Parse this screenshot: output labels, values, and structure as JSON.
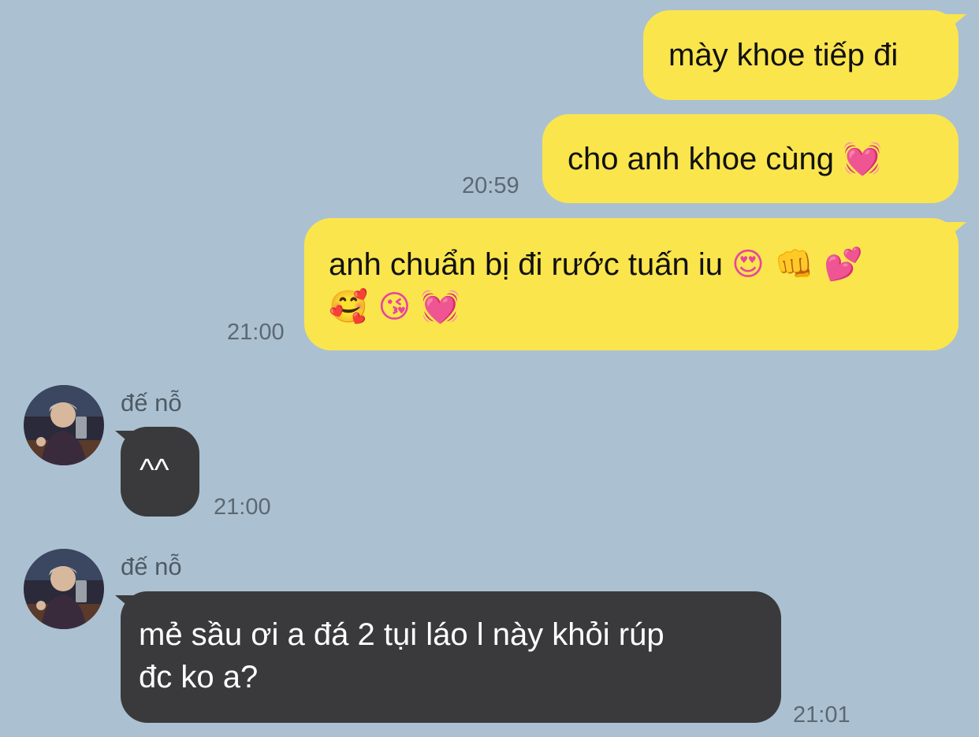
{
  "messages": {
    "m1": {
      "text": "mày khoe tiếp đi"
    },
    "m2": {
      "text": "cho anh khoe cùng",
      "emoji": "💓",
      "emoji_icon": "beating-heart-icon",
      "time": "20:59"
    },
    "m3": {
      "line1": "anh chuẩn bị đi rước tuấn iu",
      "line1_emojis": "😍 👊 💕",
      "line2_emojis": "🥰 😘 💓",
      "time": "21:00"
    },
    "m4": {
      "sender": "đế nỗ",
      "text": "^^",
      "time": "21:00"
    },
    "m5": {
      "sender": "đế nỗ",
      "line1": "mẻ sầu ơi a đá 2 tụi láo l này khỏi rúp",
      "line2": "đc ko a?",
      "time": "21:01"
    }
  },
  "colors": {
    "background": "#abc1d1",
    "outgoing_bubble": "#fae54d",
    "incoming_bubble": "#3a3a3c"
  }
}
